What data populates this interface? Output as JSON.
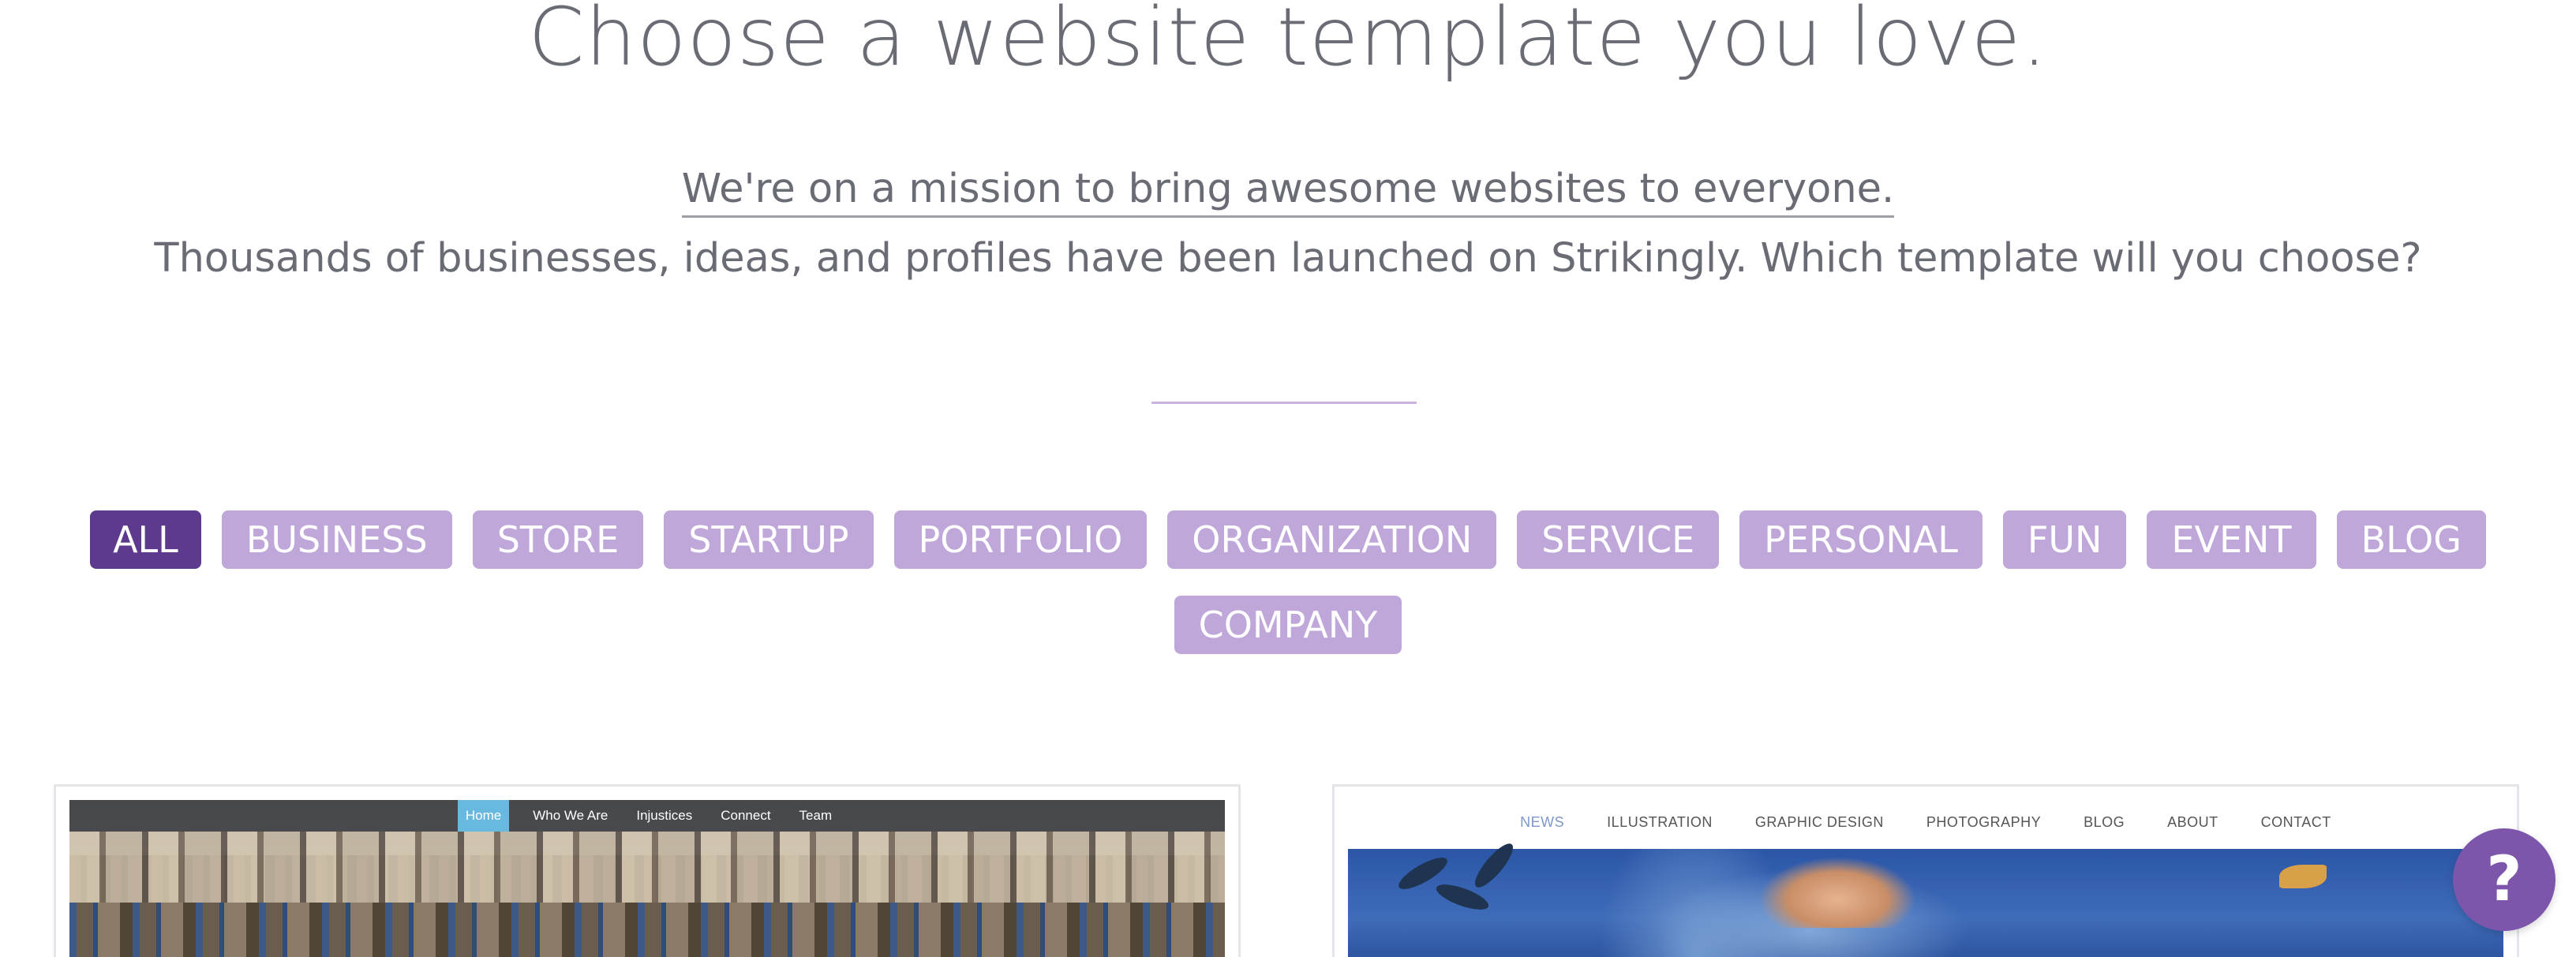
{
  "header": {
    "headline": "Choose a website template you love.",
    "mission": "We're on a mission to bring awesome websites to everyone.",
    "subtext": "Thousands of businesses, ideas, and profiles have been launched on Strikingly. Which template will you choose?"
  },
  "filters": {
    "active": "ALL",
    "row1": [
      "ALL",
      "BUSINESS",
      "STORE",
      "STARTUP",
      "PORTFOLIO",
      "ORGANIZATION",
      "SERVICE",
      "PERSONAL",
      "FUN",
      "EVENT",
      "BLOG"
    ],
    "row2": [
      "COMPANY"
    ]
  },
  "templates": [
    {
      "nav": [
        "Home",
        "Who We Are",
        "Injustices",
        "Connect",
        "Team"
      ],
      "active_nav": "Home"
    },
    {
      "nav": [
        "NEWS",
        "ILLUSTRATION",
        "GRAPHIC DESIGN",
        "PHOTOGRAPHY",
        "BLOG",
        "ABOUT",
        "CONTACT"
      ],
      "active_nav": "NEWS"
    }
  ],
  "help": {
    "label": "?"
  },
  "colors": {
    "filter_active": "#5d3a8d",
    "filter_inactive": "#bfa7da",
    "help_button": "#7d56ac",
    "divider": "#c7b3dd"
  }
}
